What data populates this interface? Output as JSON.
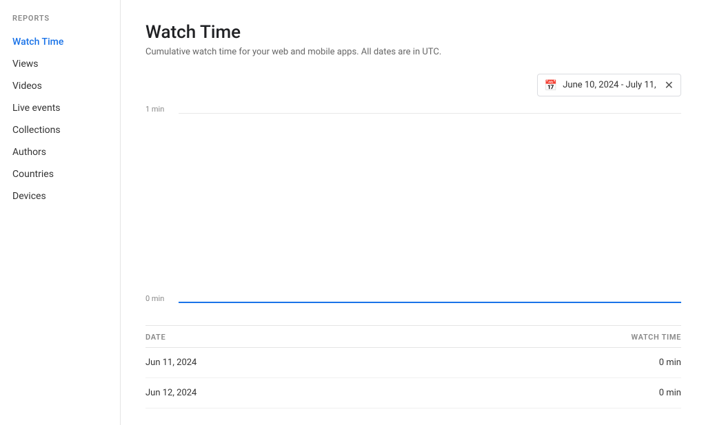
{
  "sidebar": {
    "section_label": "REPORTS",
    "items": [
      {
        "id": "watch-time",
        "label": "Watch Time",
        "active": true
      },
      {
        "id": "views",
        "label": "Views",
        "active": false
      },
      {
        "id": "videos",
        "label": "Videos",
        "active": false
      },
      {
        "id": "live-events",
        "label": "Live events",
        "active": false
      },
      {
        "id": "collections",
        "label": "Collections",
        "active": false
      },
      {
        "id": "authors",
        "label": "Authors",
        "active": false
      },
      {
        "id": "countries",
        "label": "Countries",
        "active": false
      },
      {
        "id": "devices",
        "label": "Devices",
        "active": false
      }
    ]
  },
  "main": {
    "title": "Watch Time",
    "subtitle": "Cumulative watch time for your web and mobile apps. All dates are in UTC.",
    "date_filter": "June 10, 2024 - July 11,",
    "chart": {
      "y_max_label": "1 min",
      "y_min_label": "0 min"
    },
    "table": {
      "col_date": "DATE",
      "col_watch_time": "WATCH TIME",
      "rows": [
        {
          "date": "Jun 11, 2024",
          "watch_time": "0 min"
        },
        {
          "date": "Jun 12, 2024",
          "watch_time": "0 min"
        }
      ]
    }
  },
  "icons": {
    "calendar": "📅",
    "close": "✕"
  }
}
